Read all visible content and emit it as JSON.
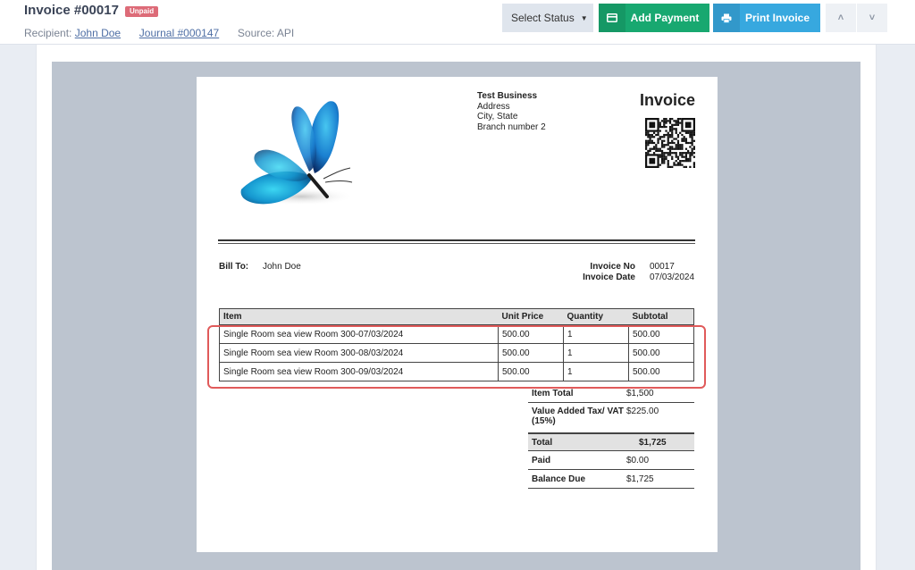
{
  "header": {
    "title": "Invoice #00017",
    "badge": "Unpaid",
    "recipient_label": "Recipient:",
    "recipient_name": "John Doe",
    "journal": "Journal #000147",
    "source": "Source: API"
  },
  "toolbar": {
    "select_status": "Select Status",
    "add_payment": "Add Payment",
    "print_invoice": "Print Invoice",
    "prev_glyph": "˄",
    "next_glyph": "˅",
    "caret_glyph": "▼"
  },
  "invoice": {
    "business": {
      "name": "Test Business",
      "address": "Address",
      "city": "City, State",
      "branch": "Branch number 2"
    },
    "doc_title": "Invoice",
    "bill_to_label": "Bill To:",
    "bill_to_name": "John Doe",
    "invoice_no_label": "Invoice No",
    "invoice_no": "00017",
    "invoice_date_label": "Invoice Date",
    "invoice_date": "07/03/2024",
    "columns": [
      "Item",
      "Unit Price",
      "Quantity",
      "Subtotal"
    ],
    "items": [
      {
        "item": "Single Room sea view Room 300-07/03/2024",
        "price": "500.00",
        "qty": "1",
        "subtotal": "500.00"
      },
      {
        "item": "Single Room sea view Room 300-08/03/2024",
        "price": "500.00",
        "qty": "1",
        "subtotal": "500.00"
      },
      {
        "item": "Single Room sea view Room 300-09/03/2024",
        "price": "500.00",
        "qty": "1",
        "subtotal": "500.00"
      }
    ],
    "totals": {
      "item_total_label": "Item Total",
      "item_total": "$1,500",
      "vat_label": "Value Added Tax/ VAT (15%)",
      "vat": "$225.00",
      "total_label": "Total",
      "total": "$1,725",
      "paid_label": "Paid",
      "paid": "$0.00",
      "balance_label": "Balance Due",
      "balance": "$1,725"
    }
  },
  "colors": {
    "badge": "#dd6b78",
    "add_payment": "#18a870",
    "print_invoice": "#37a8df",
    "highlight": "#e05a5a",
    "viewer_bg": "#bcc4cf"
  },
  "icons": {
    "add_payment": "credit-card-icon",
    "print_invoice": "printer-icon",
    "logo": "butterfly-logo"
  }
}
